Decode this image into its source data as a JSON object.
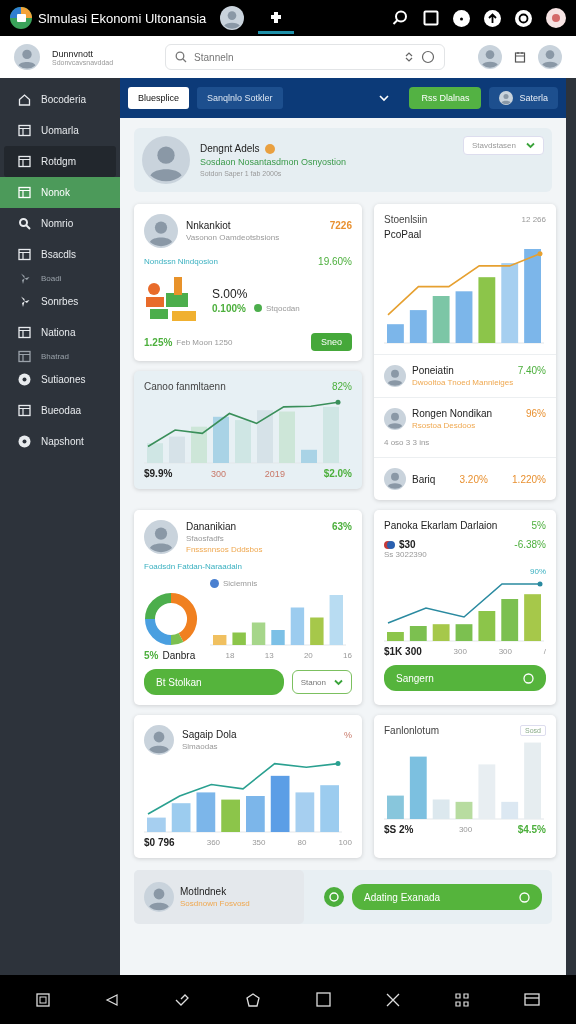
{
  "top_bar": {
    "title": "Slmulasi Ekonomi Ultonansia"
  },
  "header": {
    "user_name": "Dunnvnott",
    "user_subtitle": "Sdonvcavsnavddad",
    "search": {
      "placeholder": "Stanneln"
    }
  },
  "sidebar": {
    "items": [
      {
        "label": "Bocoderia",
        "kind": "main",
        "selected": false,
        "focused": false
      },
      {
        "label": "Uomarla",
        "kind": "main",
        "selected": false,
        "focused": false
      },
      {
        "label": "Rotdgm",
        "kind": "main",
        "selected": false,
        "focused": true
      },
      {
        "label": "Nonok",
        "kind": "main",
        "selected": true,
        "focused": false
      },
      {
        "label": "Nomrio",
        "kind": "main",
        "selected": false,
        "focused": false
      },
      {
        "label": "Bsacdls",
        "kind": "main",
        "selected": false,
        "focused": false
      },
      {
        "label": "Boadi",
        "kind": "sub",
        "selected": false,
        "focused": false
      },
      {
        "label": "Sonrbes",
        "kind": "main",
        "selected": false,
        "focused": false
      },
      {
        "label": "Nationa",
        "kind": "main",
        "selected": false,
        "focused": false
      },
      {
        "label": "Bhatrad",
        "kind": "sub",
        "selected": false,
        "focused": false
      },
      {
        "label": "Sutiaones",
        "kind": "main",
        "selected": false,
        "focused": false
      },
      {
        "label": "Bueodaa",
        "kind": "main",
        "selected": false,
        "focused": false
      },
      {
        "label": "Napshont",
        "kind": "main",
        "selected": false,
        "focused": false
      }
    ]
  },
  "toolbar": {
    "tabs": [
      {
        "label": "Bluesplice",
        "selected": true
      },
      {
        "label": "Sanqlnlo Sotkler",
        "selected": false
      }
    ],
    "action_button": "Rss Dlalnas",
    "user_button": "Saterla"
  },
  "profile": {
    "name": "Dengnt Adels",
    "headline": "Sosdaon Nosantasdmon Osnyostion",
    "meta": "Sotdon Saper 1 fab 2000s",
    "dropdown": "Stavdstasen"
  },
  "summary_card": {
    "title": "Nnkankiot",
    "value": "7226",
    "subtitle": "Vasonon Oamdeotsbsions",
    "metric_label": "Nondssn Nlndqosion",
    "metric_value": "19.60%",
    "amount": "S.00%",
    "change": "0.100%",
    "legend": "Stqocdan",
    "footer_value": "1.25%",
    "footer_note": "Feb Moon 1250",
    "button": "Sneo"
  },
  "trend_card": {
    "title": "Stoenlsiin",
    "count": "12 266",
    "subtitle": "PcoPaal",
    "rows": [
      {
        "name": "Poneiatin",
        "value": "7.40%",
        "note": "Dwooltoa Tnoed Mannleiges"
      },
      {
        "name": "Rongen Nondikan",
        "value": "96%",
        "note": "Rsostoa Desdoos",
        "meta": "4 oso 3 3 ins"
      },
      {
        "name": "Bariq",
        "value": "3.20%",
        "value_2": "1.220%"
      }
    ]
  },
  "growth_card": {
    "title": "Canoo fanmltaenn",
    "value": "82%",
    "stats": [
      "$9.9%",
      "300",
      "2019",
      "$2.0%"
    ]
  },
  "breakdown_card": {
    "title": "Dananikian",
    "value": "63%",
    "subtitle": "Sfaosfadfs",
    "note": "Fnsssnnsos Dddsbos",
    "metric_label": "Foadsdn Fatdan-Naraadaln",
    "legend": "Siciemnis",
    "share": "5%",
    "share_label": "Danbra",
    "axis": [
      "18",
      "13",
      "20",
      "16"
    ],
    "button": "Bt Stolkan",
    "dropdown": "Stanon"
  },
  "forecast_card": {
    "title": "Panoka Ekarlam Darlaion",
    "value": "5%",
    "amount": "$30",
    "change": "-6.38%",
    "meta": "Ss 3022390",
    "peak": "90%",
    "stats": [
      "$1K 300",
      "300",
      "300",
      "/"
    ],
    "button": "Sangern"
  },
  "sales_card": {
    "title": "Sagaip Dola",
    "value": "%",
    "subtitle": "Slmaodas",
    "stats": [
      "$0 796",
      "360",
      "350",
      "80",
      "100"
    ]
  },
  "distribution_card": {
    "title": "Fanlonlotum",
    "badge": "Sosd",
    "stats": [
      "$S 2%",
      "300",
      "$4.5%"
    ]
  },
  "footer": {
    "name": "Motlndnek",
    "note": "Sosdnown Fosvosd",
    "button": "Adating Exanada"
  }
}
